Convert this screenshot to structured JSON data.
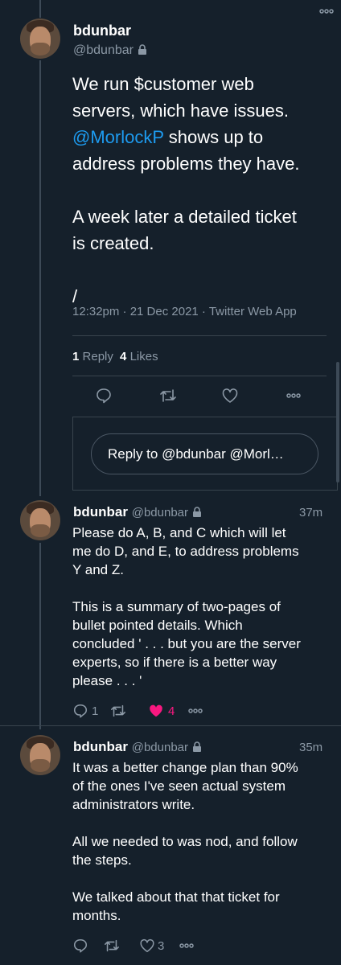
{
  "main_tweet": {
    "name": "bdunbar",
    "handle": "@bdunbar",
    "line1": "We run $customer web",
    "line2": "servers, which have issues.",
    "mention": "@MorlockP",
    "line3_rest": " shows up to",
    "line4": "address problems they have.",
    "line5": "A week later a detailed ticket",
    "line6": "is created.",
    "line7": "/",
    "timestamp": "12:32pm · 21 Dec 2021 · Twitter Web App",
    "reply_count": "1",
    "reply_label": "Reply",
    "like_count": "4",
    "like_label": "Likes"
  },
  "reply_box": {
    "placeholder": "Reply to @bdunbar @Morl…"
  },
  "reply1": {
    "name": "bdunbar",
    "handle": "@bdunbar",
    "time": "37m",
    "lines": [
      "Please do A, B, and C which will let",
      "me do D, and E, to address problems",
      "Y and Z.",
      "",
      "This is a summary of two-pages of",
      "bullet pointed details.  Which",
      "concluded ' . . . but you are the server",
      "experts, so if there is a better way",
      "please . . . '"
    ],
    "reply_count": "1",
    "like_count": "4",
    "like_color": "#f91880"
  },
  "reply2": {
    "name": "bdunbar",
    "handle": "@bdunbar",
    "time": "35m",
    "lines": [
      "It was a better change plan than 90%",
      "of the ones I've seen actual system",
      "administrators write.",
      "",
      "All we needed to was nod, and follow",
      "the steps.",
      "",
      "We talked about that that ticket for",
      "months."
    ],
    "like_count": "3"
  },
  "colors": {
    "background": "#15202b",
    "link": "#1d9bf0",
    "muted": "#8b98a5"
  }
}
